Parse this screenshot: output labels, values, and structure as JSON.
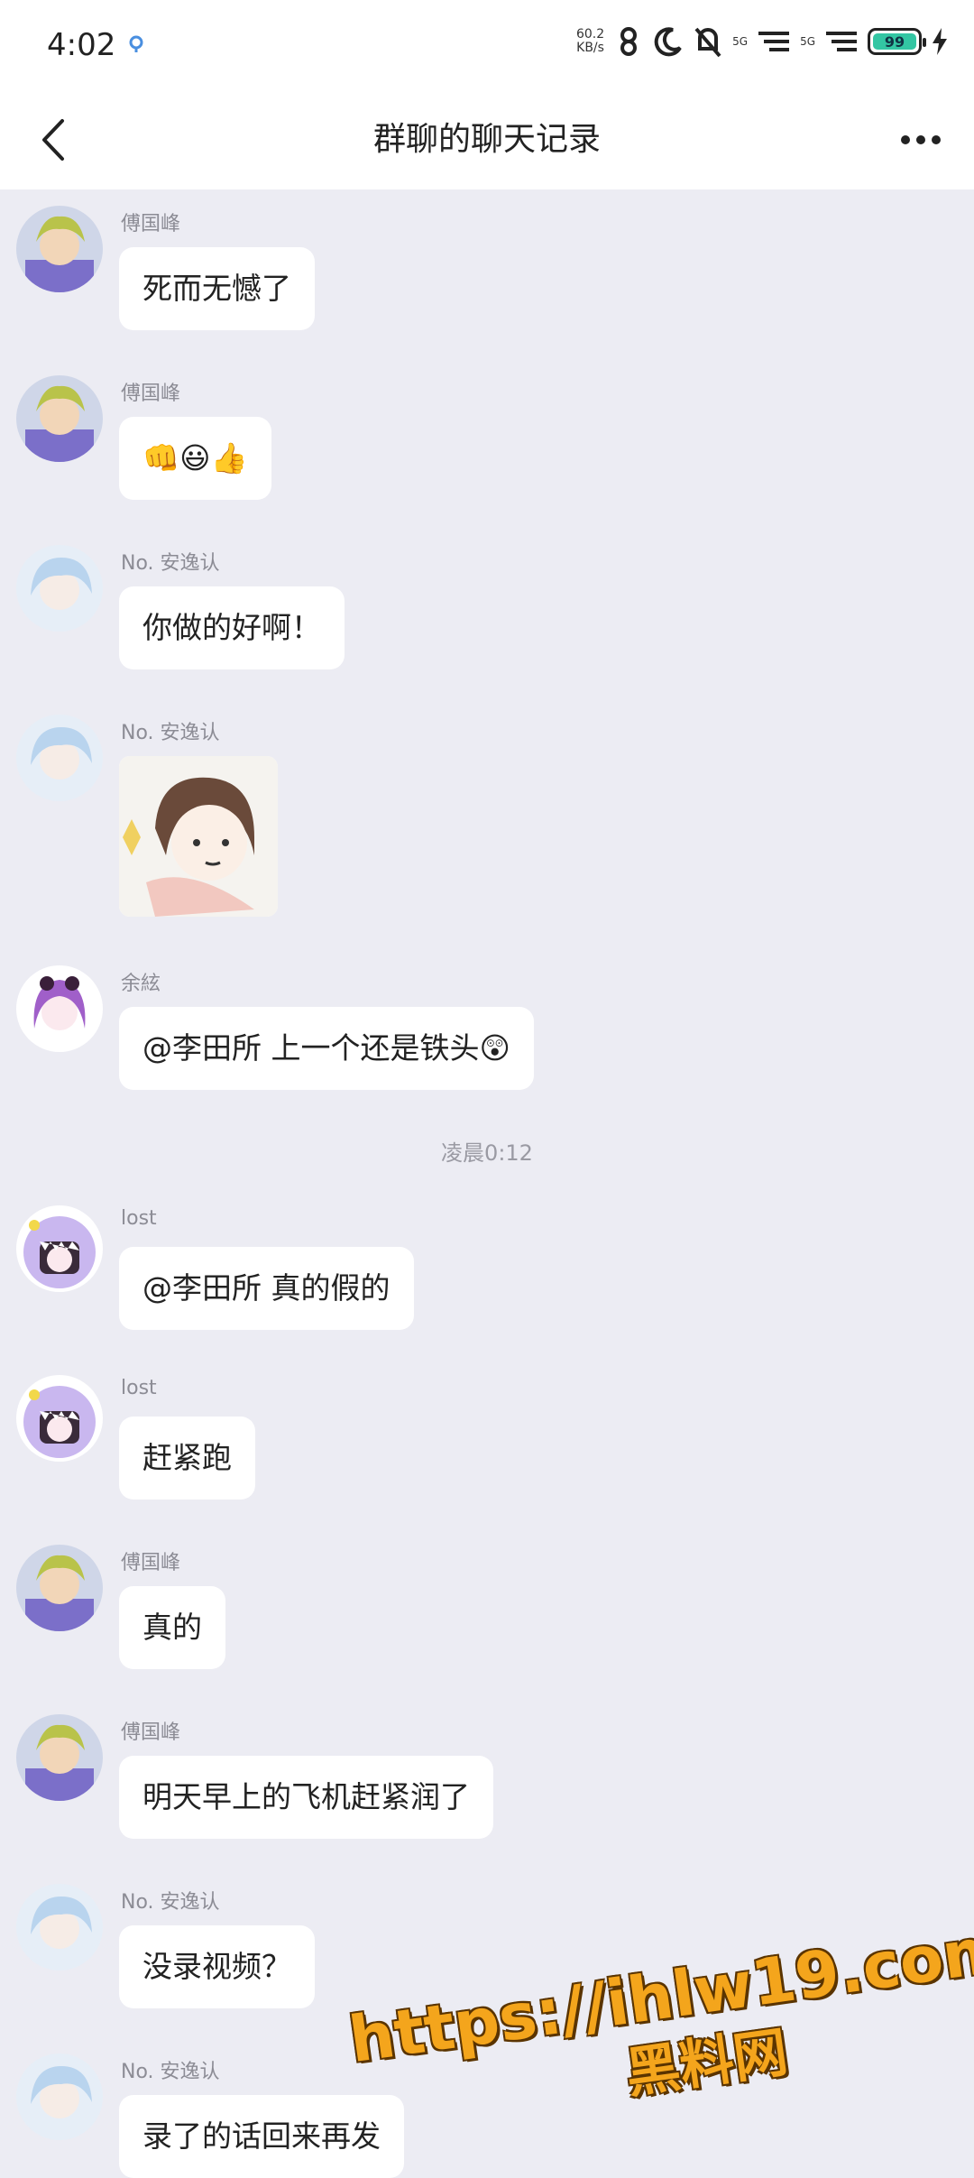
{
  "status_bar": {
    "time": "4:02",
    "net_speed_value": "60.2",
    "net_speed_unit": "KB/s",
    "sim1": "5G",
    "sim2": "5G",
    "battery_level": "99"
  },
  "header": {
    "title": "群聊的聊天记录"
  },
  "messages": [
    {
      "sender": "傅国峰",
      "text": "死而无憾了",
      "avatar": "avatar-green-hair"
    },
    {
      "sender": "傅国峰",
      "text": "👊😃👍",
      "avatar": "avatar-green-hair"
    },
    {
      "sender": "No. 安逸认",
      "text": "你做的好啊！",
      "avatar": "avatar-white-hair"
    },
    {
      "sender": "No. 安逸认",
      "sticker": "anime-sticker",
      "avatar": "avatar-white-hair"
    },
    {
      "sender": "余絃",
      "text": "@李田所 上一个还是铁头😲",
      "avatar": "avatar-purple-hair"
    },
    {
      "sender": "lost",
      "text": "@李田所 真的假的",
      "avatar": "avatar-dino-hood"
    },
    {
      "sender": "lost",
      "text": "赶紧跑",
      "avatar": "avatar-dino-hood"
    },
    {
      "sender": "傅国峰",
      "text": "真的",
      "avatar": "avatar-green-hair"
    },
    {
      "sender": "傅国峰",
      "text": "明天早上的飞机赶紧润了",
      "avatar": "avatar-green-hair"
    },
    {
      "sender": "No. 安逸认",
      "text": "没录视频？",
      "avatar": "avatar-white-hair"
    },
    {
      "sender": "No. 安逸认",
      "text": "录了的话回来再发",
      "avatar": "avatar-white-hair"
    }
  ],
  "time_divider": "凌晨0:12",
  "watermark": {
    "line1": "https://ihlw19.com",
    "line2": "黑料网"
  },
  "colors": {
    "background": "#ececf3",
    "bubble": "#ffffff",
    "battery": "#33c6a3",
    "watermark": "#f4a51c"
  }
}
